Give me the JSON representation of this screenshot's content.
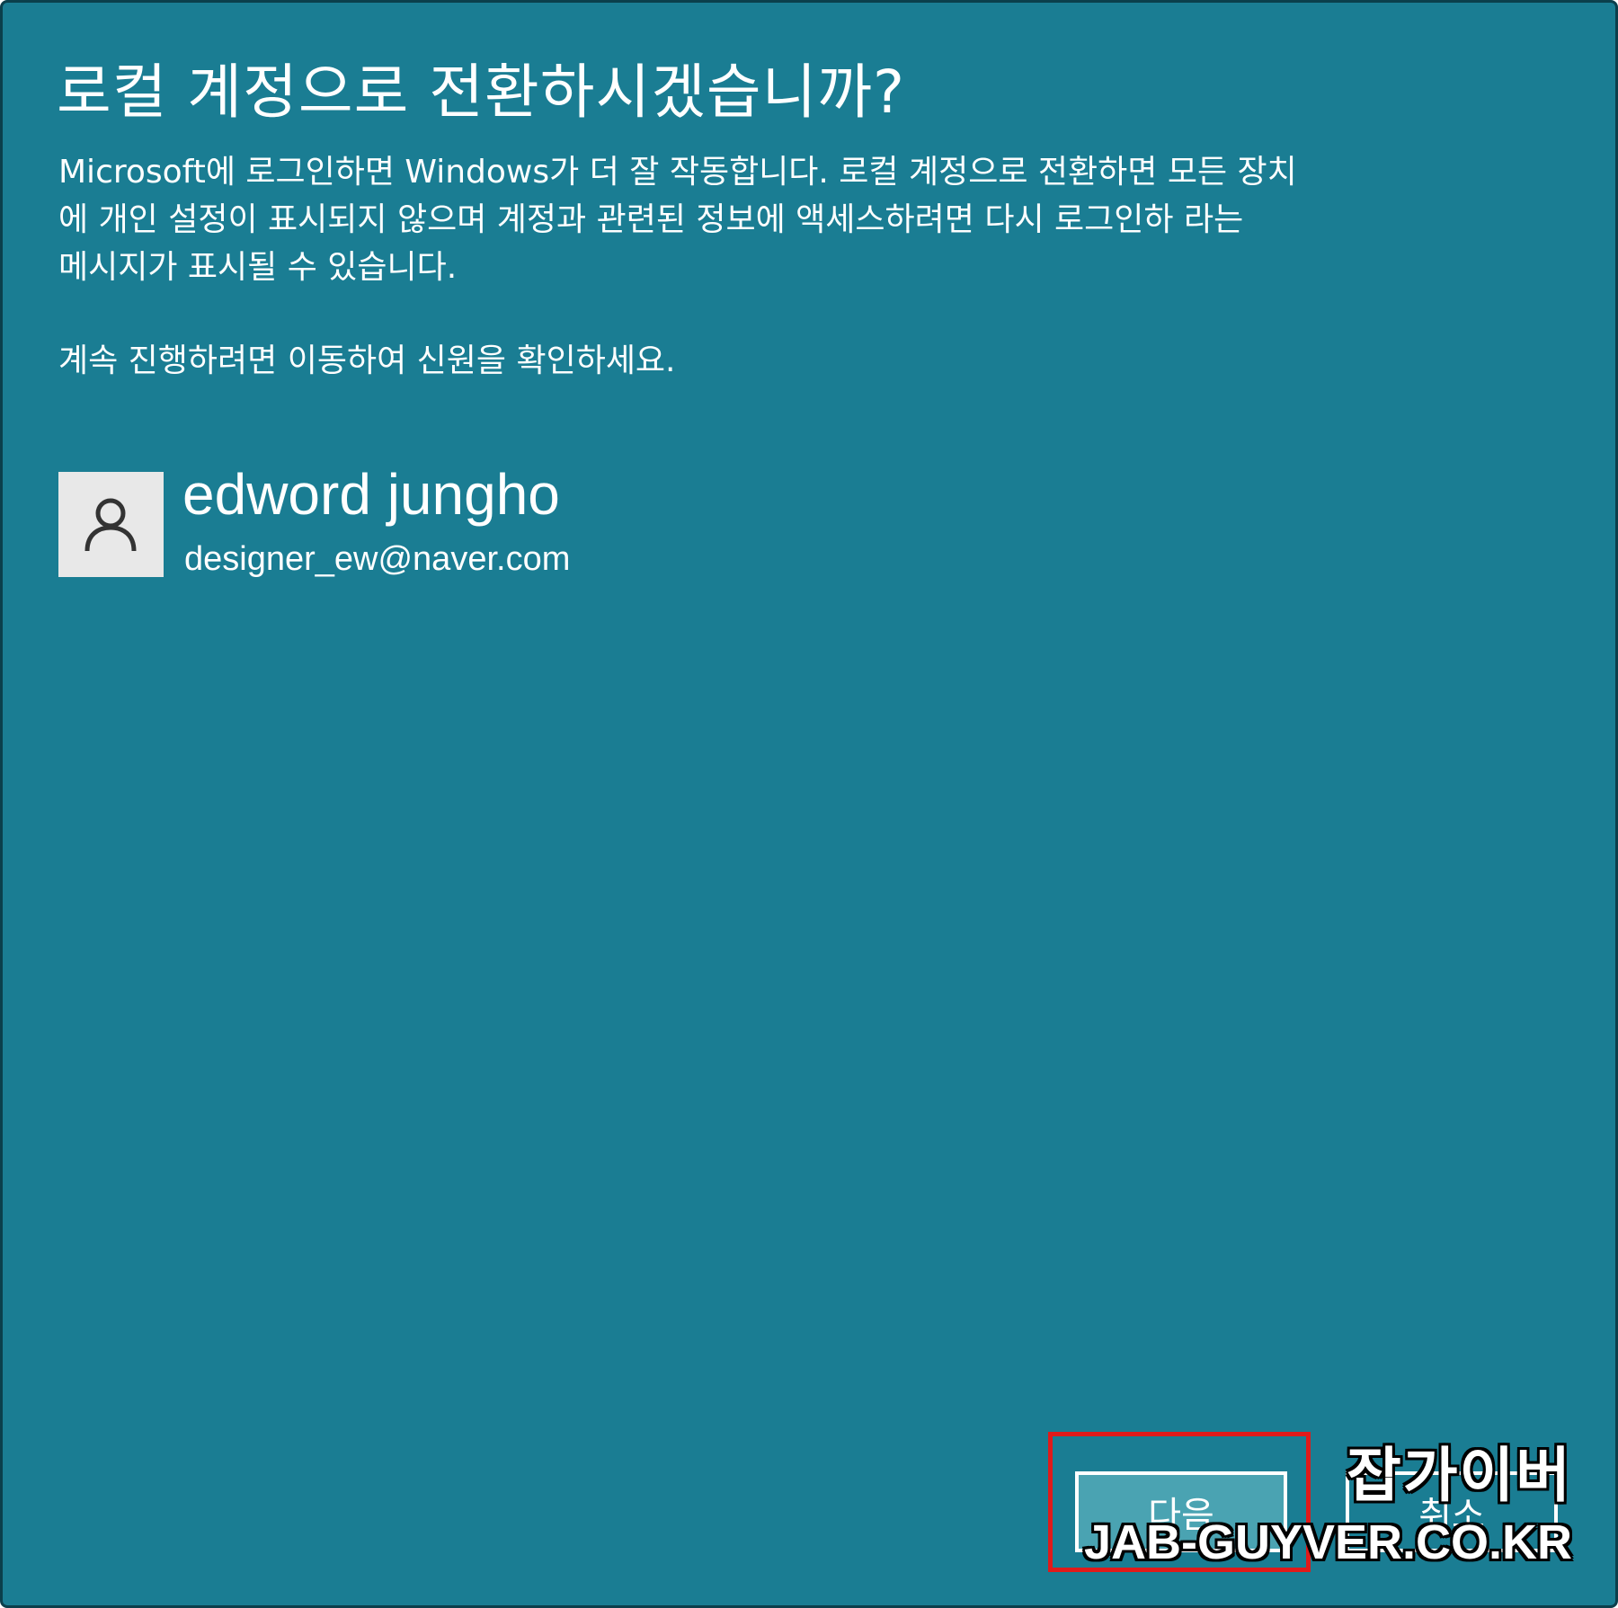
{
  "dialog": {
    "title": "로컬 계정으로 전환하시겠습니까?",
    "description": [
      "Microsoft에 로그인하면 Windows가 더 잘 작동합니다. 로컬 계정으로 전환하면 모든 장치",
      "에 개인 설정이 표시되지 않으며 계정과 관련된 정보에 액세스하려면 다시 로그인하 라는",
      "메시지가 표시될 수 있습니다."
    ],
    "continue_text": "계속 진행하려면 이동하여 신원을 확인하세요."
  },
  "account": {
    "avatar_icon": "person-icon",
    "name": "edword jungho",
    "email": "designer_ew@naver.com"
  },
  "buttons": {
    "next_label": "다음",
    "cancel_label": "취소"
  },
  "watermark": {
    "korean": "잡가이버",
    "site": "JAB-GUYVER.CO.KR"
  },
  "colors": {
    "background": "#1a7d93",
    "highlight": "#e01a1a",
    "next_button": "#4aa3b2"
  }
}
